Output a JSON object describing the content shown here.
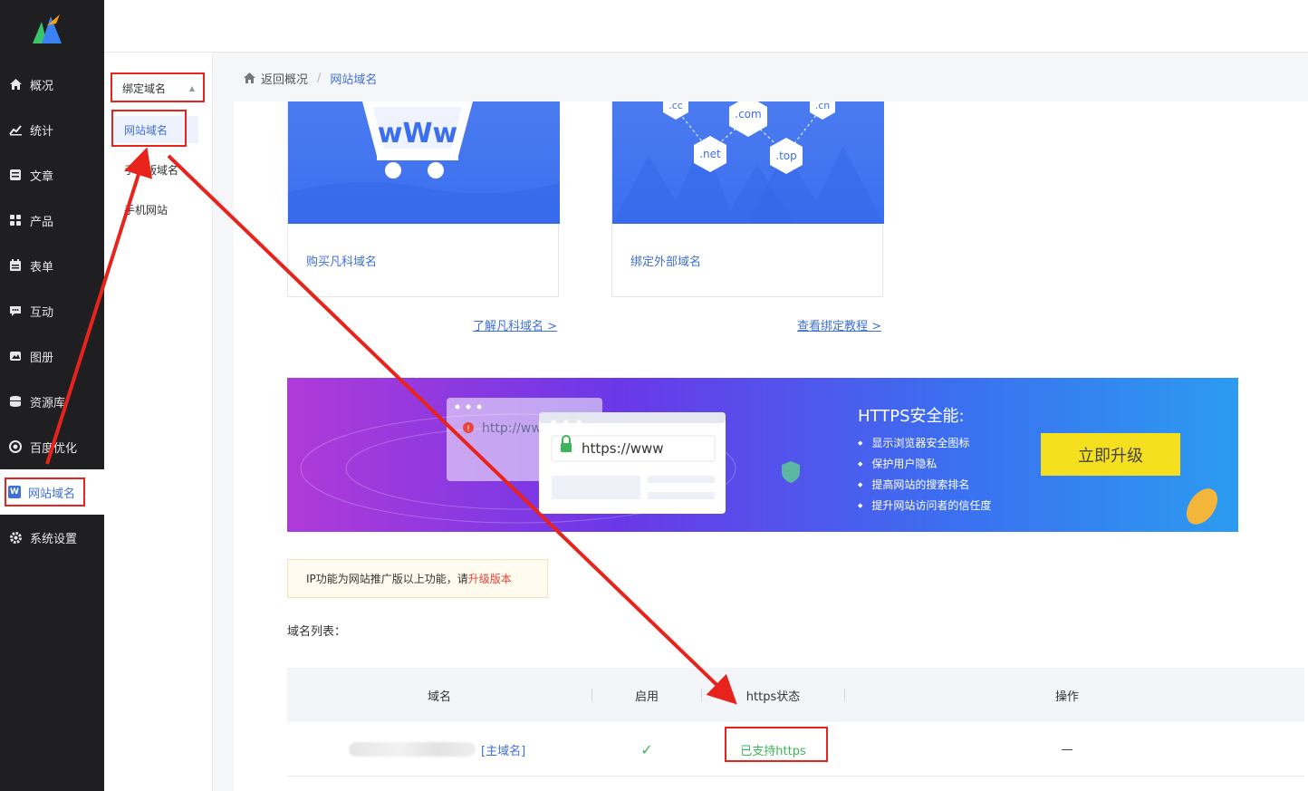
{
  "colors": {
    "accent": "#3f6fd8",
    "annotation": "#e8231c",
    "success": "#3cb55a",
    "upgrade": "#f4e01f"
  },
  "sidebar": {
    "items": [
      {
        "label": "概况",
        "icon": "home-icon"
      },
      {
        "label": "统计",
        "icon": "stats-icon"
      },
      {
        "label": "文章",
        "icon": "article-icon"
      },
      {
        "label": "产品",
        "icon": "product-icon"
      },
      {
        "label": "表单",
        "icon": "form-icon"
      },
      {
        "label": "互动",
        "icon": "chat-icon"
      },
      {
        "label": "图册",
        "icon": "gallery-icon"
      },
      {
        "label": "资源库",
        "icon": "database-icon"
      },
      {
        "label": "百度优化",
        "icon": "seo-icon"
      },
      {
        "label": "网站域名",
        "icon": "domain-icon",
        "badge": "W"
      },
      {
        "label": "系统设置",
        "icon": "gear-icon"
      }
    ]
  },
  "submenu": {
    "title": "绑定域名",
    "items": [
      "网站域名",
      "手机版域名",
      "手机网站"
    ]
  },
  "breadcrumb": {
    "back": "返回概况",
    "sep": "/",
    "current": "网站域名"
  },
  "cards": [
    {
      "label": "购买凡科域名",
      "link": "了解凡科域名 >",
      "art": "wWw"
    },
    {
      "label": "绑定外部域名",
      "link": "查看绑定教程 >",
      "tlds": [
        ".cc",
        ".com",
        ".cn",
        ".net",
        ".top"
      ]
    }
  ],
  "https_banner": {
    "title": "HTTPS安全能:",
    "features": [
      "显示浏览器安全图标",
      "保护用户隐私",
      "提高网站的搜索排名",
      "提升网站访问者的信任度"
    ],
    "button": "立即升级",
    "old_url": "http://www",
    "new_url": "https://www"
  },
  "notice": {
    "text": "IP功能为网站推广版以上功能，请",
    "link": "升级版本"
  },
  "domain_list": {
    "label": "域名列表：",
    "columns": [
      "域名",
      "启用",
      "https状态",
      "操作"
    ],
    "rows": [
      {
        "tag": "[主域名]",
        "enabled": "✓",
        "https": "已支持https",
        "action": "—"
      }
    ]
  }
}
